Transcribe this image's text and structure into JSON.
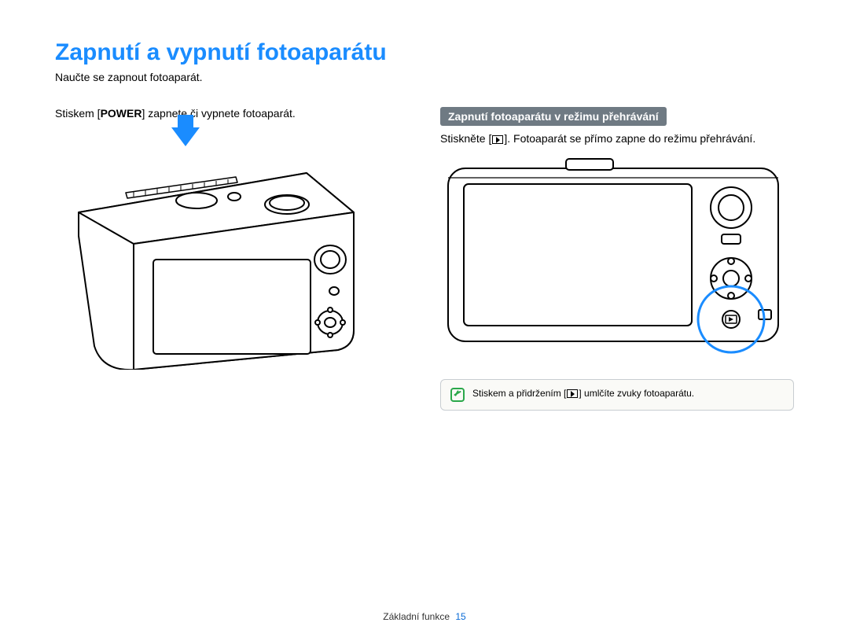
{
  "title": "Zapnutí a vypnutí fotoaparátu",
  "subtitle": "Naučte se zapnout fotoaparát.",
  "left": {
    "instruction_pre": "Stiskem [",
    "instruction_strong": "POWER",
    "instruction_post": "] zapnete či vypnete fotoaparát."
  },
  "right": {
    "section_header": "Zapnutí fotoaparátu v režimu přehrávání",
    "press_pre": "Stiskněte [",
    "press_post": "]. Fotoaparát se přímo zapne do režimu přehrávání.",
    "note_pre": "Stiskem a přidržením [",
    "note_post": "] umlčíte zvuky fotoaparátu."
  },
  "footer": {
    "label": "Základní funkce",
    "page": "15"
  }
}
